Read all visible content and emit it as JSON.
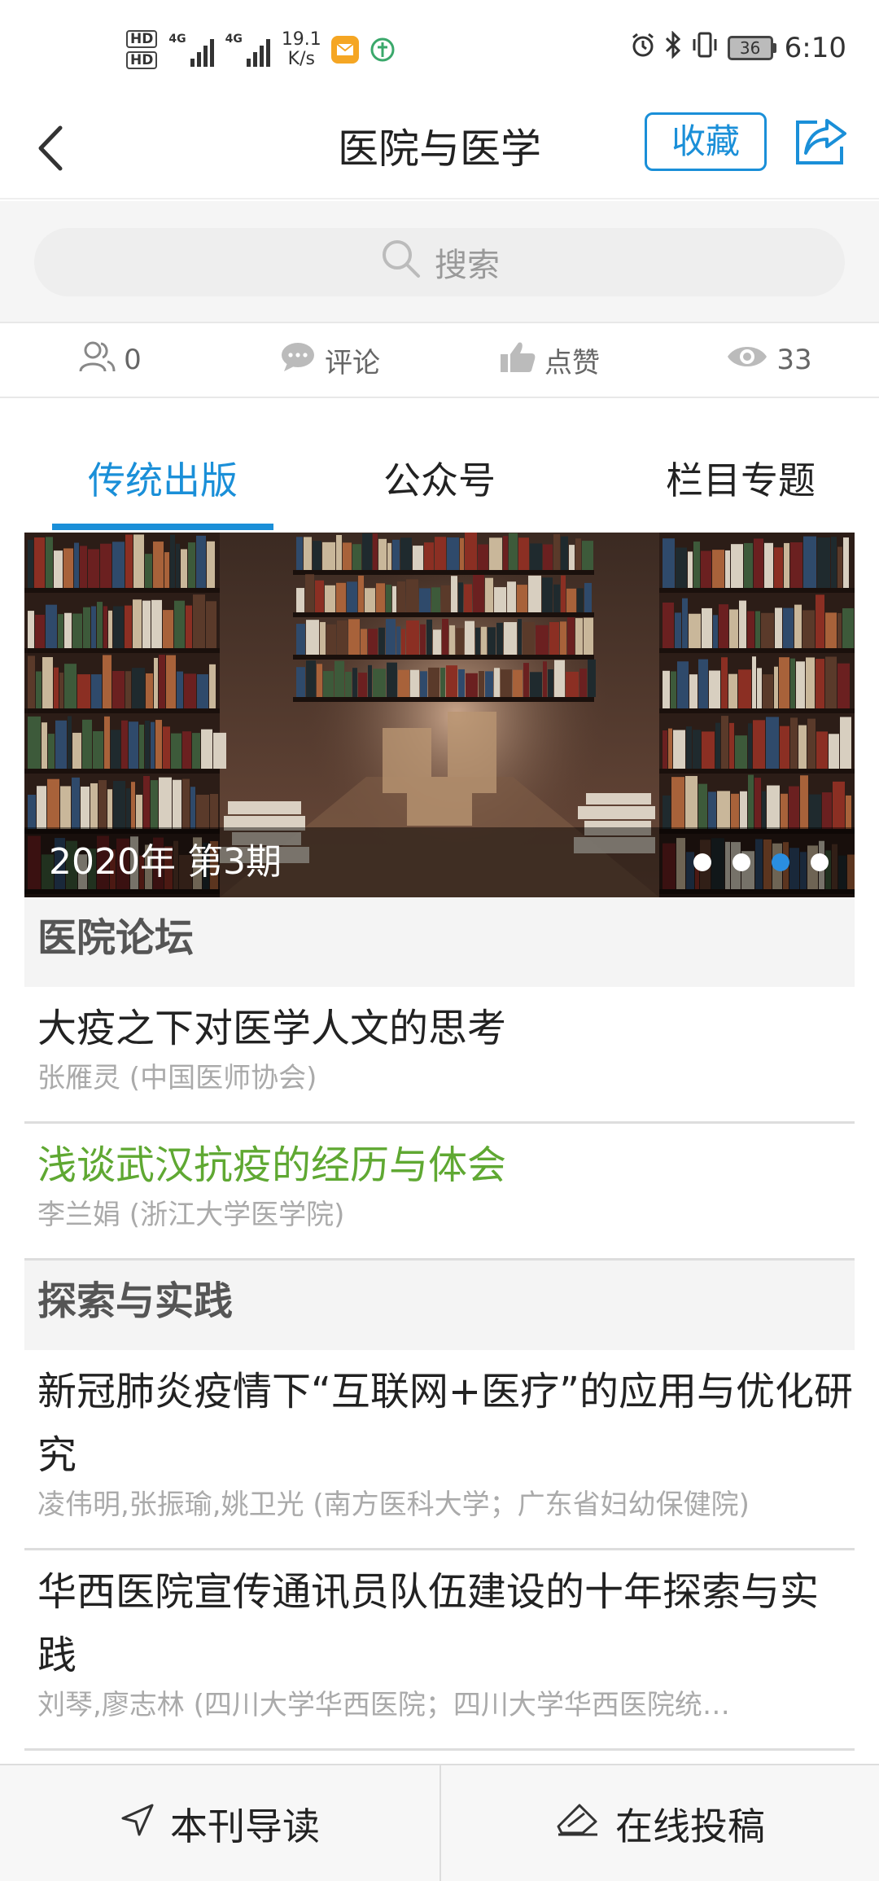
{
  "status_bar": {
    "hd1": "HD",
    "hd2": "HD",
    "net1": "4G",
    "net2": "4G",
    "speed_value": "19.1",
    "speed_unit": "K/s",
    "battery": "36",
    "time": "6:10"
  },
  "header": {
    "title": "医院与医学",
    "favorite_label": "收藏"
  },
  "search": {
    "placeholder": "搜索"
  },
  "stats": {
    "followers": "0",
    "comment_label": "评论",
    "like_label": "点赞",
    "views": "33"
  },
  "tabs": [
    {
      "label": "传统出版"
    },
    {
      "label": "公众号"
    },
    {
      "label": "栏目专题"
    }
  ],
  "banner": {
    "caption": "2020年 第3期",
    "dot_count": 4,
    "active_dot": 3
  },
  "sections": [
    {
      "title": "医院论坛",
      "articles": [
        {
          "title": "大疫之下对医学人文的思考",
          "author": "张雁灵 (中国医师协会)"
        },
        {
          "title": "浅谈武汉抗疫的经历与体会",
          "author": "李兰娟 (浙江大学医学院)"
        }
      ]
    },
    {
      "title": "探索与实践",
      "articles": [
        {
          "title": "新冠肺炎疫情下“互联网+医疗”的应用与优化研究",
          "author": "凌伟明,张振瑜,姚卫光 (南方医科大学；广东省妇幼保健院)"
        },
        {
          "title": "华西医院宣传通讯员队伍建设的十年探索与实践",
          "author": "刘琴,廖志林 (四川大学华西医院；四川大学华西医院统…"
        }
      ]
    }
  ],
  "bottom_bar": {
    "guide_label": "本刊导读",
    "submit_label": "在线投稿"
  },
  "colors": {
    "accent": "#1a8fd8",
    "visited_link": "#5fa832"
  }
}
